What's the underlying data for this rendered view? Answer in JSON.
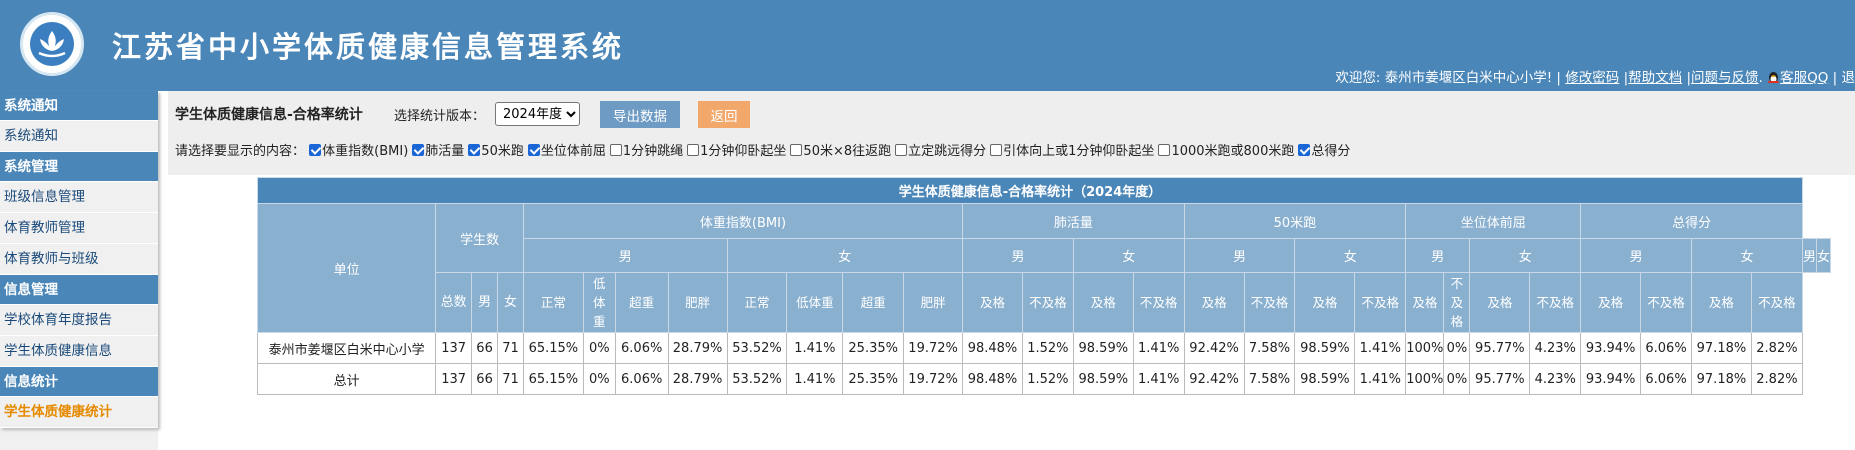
{
  "header": {
    "title": "江苏省中小学体质健康信息管理系统",
    "welcome": "欢迎您: 泰州市姜堰区白米中心小学! |",
    "links": [
      "修改密码",
      "帮助文档",
      "问题与反馈"
    ],
    "qq_label": "客服QQ",
    "tail": "| 退",
    "sep": "|",
    "colors": {
      "header_bg": "#4a86b8",
      "accent": "#e68a00"
    }
  },
  "sidebar": {
    "sections": [
      {
        "title": "系统通知",
        "items": [
          "系统通知"
        ]
      },
      {
        "title": "系统管理",
        "items": [
          "班级信息管理",
          "体育教师管理",
          "体育教师与班级"
        ]
      },
      {
        "title": "信息管理",
        "items": [
          "学校体育年度报告",
          "学生体质健康信息"
        ]
      },
      {
        "title": "信息统计",
        "items": [
          "学生体质健康统计"
        ]
      }
    ],
    "active_item": "学生体质健康统计"
  },
  "toolbar": {
    "page_title": "学生体质健康信息-合格率统计",
    "version_label": "选择统计版本：",
    "version_value": "2024年度",
    "export_label": "导出数据",
    "back_label": "返回",
    "options_label": "请选择要显示的内容：",
    "options": [
      {
        "label": "体重指数(BMI)",
        "checked": true
      },
      {
        "label": "肺活量",
        "checked": true
      },
      {
        "label": "50米跑",
        "checked": true
      },
      {
        "label": "坐位体前屈",
        "checked": true
      },
      {
        "label": "1分钟跳绳",
        "checked": false
      },
      {
        "label": "1分钟仰卧起坐",
        "checked": false
      },
      {
        "label": "50米×8往返跑",
        "checked": false
      },
      {
        "label": "立定跳远得分",
        "checked": false
      },
      {
        "label": "引体向上或1分钟仰卧起坐",
        "checked": false
      },
      {
        "label": "1000米跑或800米跑",
        "checked": false
      },
      {
        "label": "总得分",
        "checked": true
      }
    ]
  },
  "table": {
    "title": "学生体质健康信息-合格率统计（2024年度）",
    "unit_header": "单位",
    "students_header": "学生数",
    "students_sub": [
      "总数",
      "男",
      "女"
    ],
    "groups": [
      "体重指数(BMI)",
      "肺活量",
      "50米跑",
      "坐位体前屈",
      "总得分"
    ],
    "male": "男",
    "female": "女",
    "bmi_cols": [
      "正常",
      "低体重",
      "超重",
      "肥胖"
    ],
    "pass_cols": [
      "及格",
      "不及格"
    ],
    "rows": [
      {
        "unit": "泰州市姜堰区白米中心小学",
        "cells": [
          "137",
          "66",
          "71",
          "65.15%",
          "0%",
          "6.06%",
          "28.79%",
          "53.52%",
          "1.41%",
          "25.35%",
          "19.72%",
          "98.48%",
          "1.52%",
          "98.59%",
          "1.41%",
          "92.42%",
          "7.58%",
          "98.59%",
          "1.41%",
          "100%",
          "0%",
          "95.77%",
          "4.23%",
          "93.94%",
          "6.06%",
          "97.18%",
          "2.82%"
        ]
      },
      {
        "unit": "总计",
        "cells": [
          "137",
          "66",
          "71",
          "65.15%",
          "0%",
          "6.06%",
          "28.79%",
          "53.52%",
          "1.41%",
          "25.35%",
          "19.72%",
          "98.48%",
          "1.52%",
          "98.59%",
          "1.41%",
          "92.42%",
          "7.58%",
          "98.59%",
          "1.41%",
          "100%",
          "0%",
          "95.77%",
          "4.23%",
          "93.94%",
          "6.06%",
          "97.18%",
          "2.82%"
        ]
      }
    ]
  }
}
